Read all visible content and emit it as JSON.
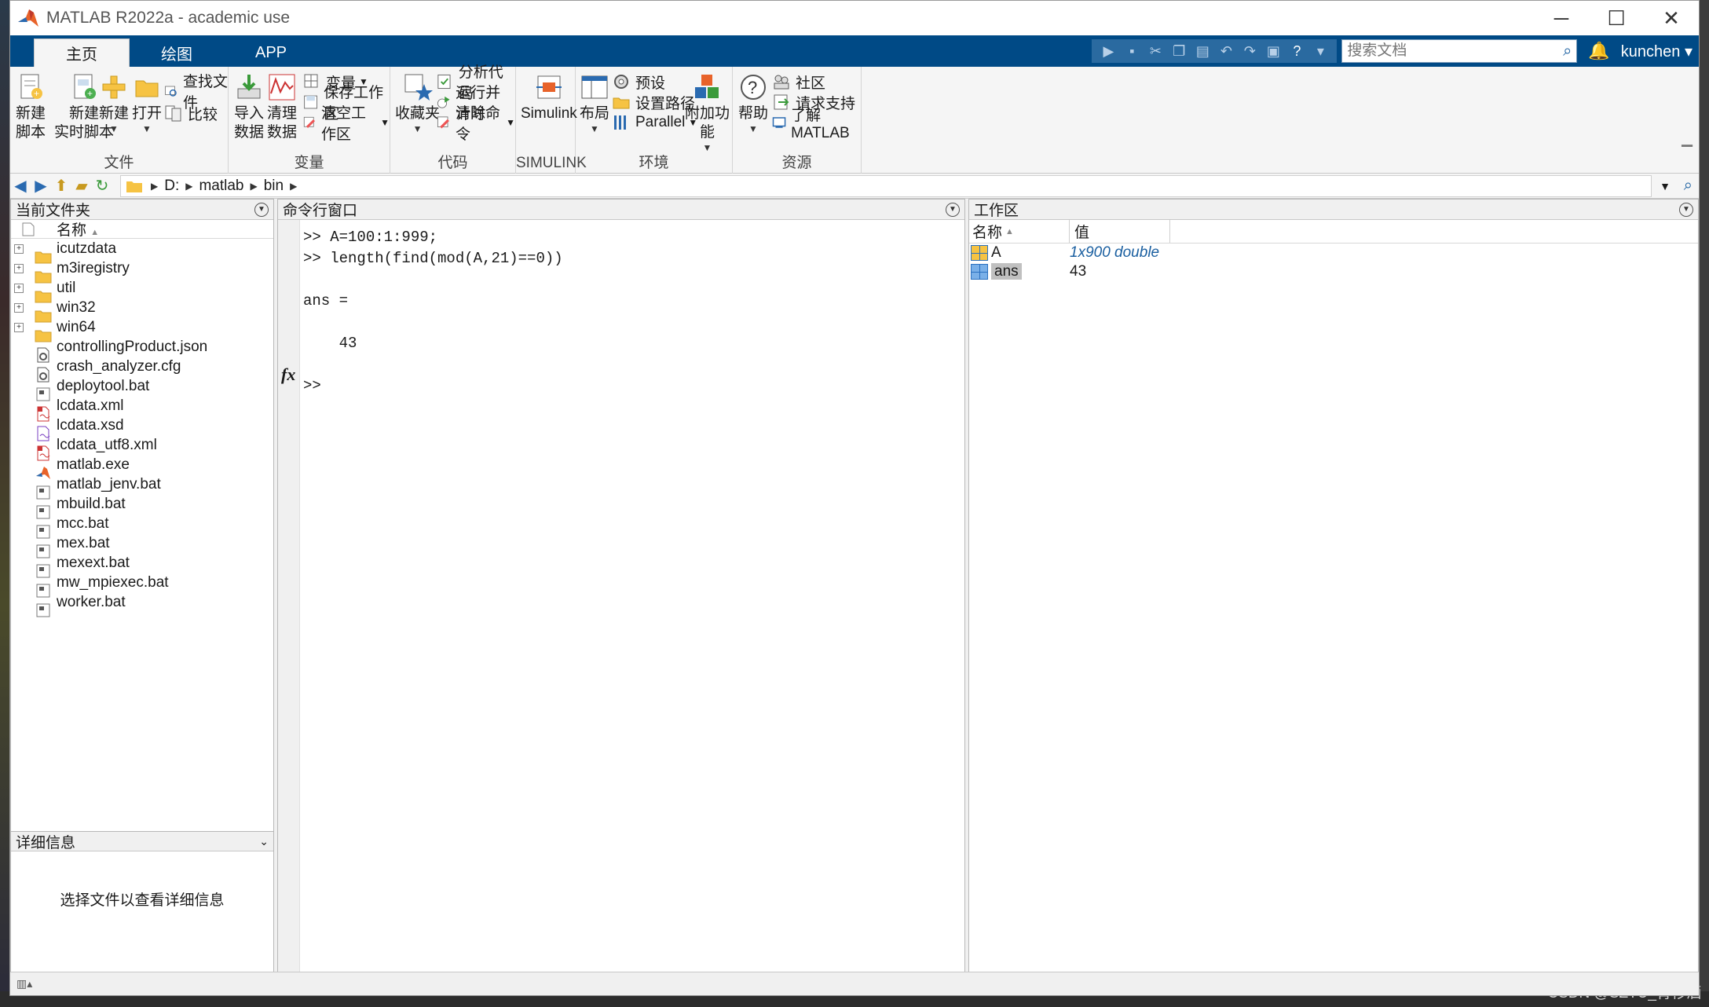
{
  "window": {
    "title": "MATLAB R2022a - academic use",
    "controls": [
      "─",
      "☐",
      "✕"
    ]
  },
  "tabs": [
    "主页",
    "绘图",
    "APP"
  ],
  "search": {
    "placeholder": "搜索文档"
  },
  "user": "kunchen",
  "ribbon": {
    "file": {
      "label": "文件",
      "new_script": [
        "新建",
        "脚本"
      ],
      "new_live_script": [
        "新建",
        "实时脚本"
      ],
      "new": "新建",
      "open": "打开",
      "find_files": "查找文件",
      "compare": "比较"
    },
    "variable": {
      "label": "变量",
      "import": [
        "导入",
        "数据"
      ],
      "clean": [
        "清理",
        "数据"
      ],
      "variable": "变量",
      "save_workspace": "保存工作区",
      "clear_workspace": "清空工作区"
    },
    "code": {
      "label": "代码",
      "favorites": "收藏夹",
      "analyze": "分析代码",
      "run_time": "运行并计时",
      "clear_commands": "清除命令"
    },
    "simulink": {
      "label": "SIMULINK",
      "simulink": "Simulink"
    },
    "environment": {
      "label": "环境",
      "layout": "布局",
      "preferences": "预设",
      "set_path": "设置路径",
      "parallel": "Parallel",
      "addons": "附加功能"
    },
    "resources": {
      "label": "资源",
      "help": "帮助",
      "community": "社区",
      "request_support": "请求支持",
      "learn": "了解 MATLAB"
    }
  },
  "address": {
    "path": [
      "D:",
      "matlab",
      "bin"
    ]
  },
  "current_folder": {
    "title": "当前文件夹",
    "column": "名称",
    "items": [
      {
        "name": "icutzdata",
        "type": "folder"
      },
      {
        "name": "m3iregistry",
        "type": "folder"
      },
      {
        "name": "util",
        "type": "folder"
      },
      {
        "name": "win32",
        "type": "folder"
      },
      {
        "name": "win64",
        "type": "folder"
      },
      {
        "name": "controllingProduct.json",
        "type": "json"
      },
      {
        "name": "crash_analyzer.cfg",
        "type": "json"
      },
      {
        "name": "deploytool.bat",
        "type": "bat"
      },
      {
        "name": "lcdata.xml",
        "type": "xml"
      },
      {
        "name": "lcdata.xsd",
        "type": "xsd"
      },
      {
        "name": "lcdata_utf8.xml",
        "type": "xml"
      },
      {
        "name": "matlab.exe",
        "type": "exe"
      },
      {
        "name": "matlab_jenv.bat",
        "type": "bat"
      },
      {
        "name": "mbuild.bat",
        "type": "bat"
      },
      {
        "name": "mcc.bat",
        "type": "bat"
      },
      {
        "name": "mex.bat",
        "type": "bat"
      },
      {
        "name": "mexext.bat",
        "type": "bat"
      },
      {
        "name": "mw_mpiexec.bat",
        "type": "bat"
      },
      {
        "name": "worker.bat",
        "type": "bat"
      }
    ]
  },
  "details": {
    "title": "详细信息",
    "empty_text": "选择文件以查看详细信息"
  },
  "command_window": {
    "title": "命令行窗口",
    "lines": [
      ">> A=100:1:999;",
      ">> length(find(mod(A,21)==0))",
      "",
      "ans =",
      "",
      "    43",
      ""
    ],
    "prompt": ">>",
    "fx": "fx"
  },
  "workspace": {
    "title": "工作区",
    "col_name": "名称",
    "col_value": "值",
    "vars": [
      {
        "name": "A",
        "value": "1x900 double"
      },
      {
        "name": "ans",
        "value": "43"
      }
    ]
  },
  "watermark": "CSDN @SZTU_青衫洒",
  "colors": {
    "tab_bar": "#004a86",
    "accent": "#1a5fa0"
  }
}
